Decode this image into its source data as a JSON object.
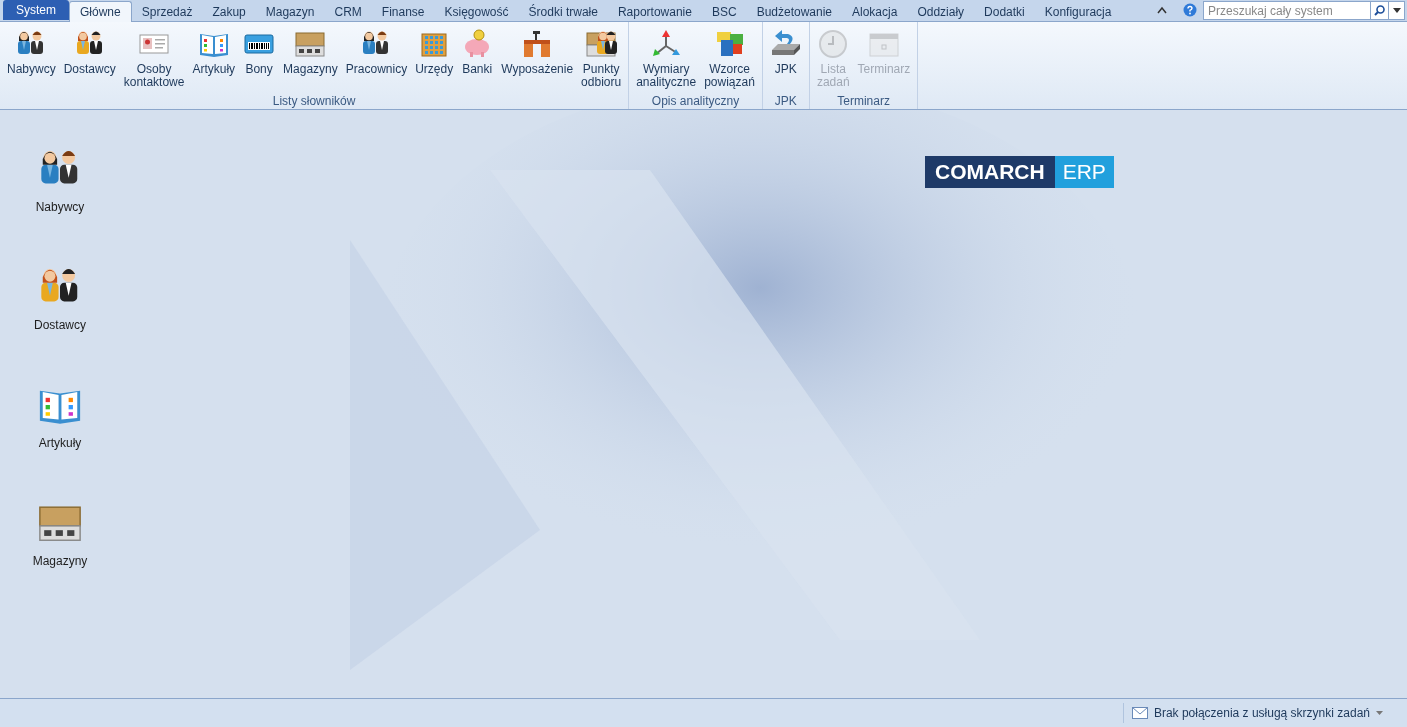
{
  "tabs": [
    {
      "label": "System",
      "kind": "system",
      "selected": false
    },
    {
      "label": "Główne",
      "kind": "tab",
      "selected": true
    },
    {
      "label": "Sprzedaż",
      "kind": "tab",
      "selected": false
    },
    {
      "label": "Zakup",
      "kind": "tab",
      "selected": false
    },
    {
      "label": "Magazyn",
      "kind": "tab",
      "selected": false
    },
    {
      "label": "CRM",
      "kind": "tab",
      "selected": false
    },
    {
      "label": "Finanse",
      "kind": "tab",
      "selected": false
    },
    {
      "label": "Księgowość",
      "kind": "tab",
      "selected": false
    },
    {
      "label": "Środki trwałe",
      "kind": "tab",
      "selected": false
    },
    {
      "label": "Raportowanie",
      "kind": "tab",
      "selected": false
    },
    {
      "label": "BSC",
      "kind": "tab",
      "selected": false
    },
    {
      "label": "Budżetowanie",
      "kind": "tab",
      "selected": false
    },
    {
      "label": "Alokacja",
      "kind": "tab",
      "selected": false
    },
    {
      "label": "Oddziały",
      "kind": "tab",
      "selected": false
    },
    {
      "label": "Dodatki",
      "kind": "tab",
      "selected": false
    },
    {
      "label": "Konfiguracja",
      "kind": "tab",
      "selected": false
    }
  ],
  "search": {
    "placeholder": "Przeszukaj cały system"
  },
  "ribbon_groups": [
    {
      "label": "Listy słowników",
      "items": [
        {
          "label": "Nabywcy",
          "kind": "buyers",
          "disabled": false
        },
        {
          "label": "Dostawcy",
          "kind": "suppliers",
          "disabled": false
        },
        {
          "label": "Osoby kontaktowe",
          "kind": "contact",
          "disabled": false
        },
        {
          "label": "Artykuły",
          "kind": "book",
          "disabled": false
        },
        {
          "label": "Bony",
          "kind": "voucher",
          "disabled": false
        },
        {
          "label": "Magazyny",
          "kind": "warehouse",
          "disabled": false
        },
        {
          "label": "Pracownicy",
          "kind": "buyers",
          "disabled": false
        },
        {
          "label": "Urzędy",
          "kind": "building",
          "disabled": false
        },
        {
          "label": "Banki",
          "kind": "piggy",
          "disabled": false
        },
        {
          "label": "Wyposażenie",
          "kind": "desk",
          "disabled": false
        },
        {
          "label": "Punkty odbioru",
          "kind": "pickup",
          "disabled": false
        }
      ]
    },
    {
      "label": "Opis analityczny",
      "items": [
        {
          "label": "Wymiary analityczne",
          "kind": "axes",
          "disabled": false
        },
        {
          "label": "Wzorce powiązań",
          "kind": "blocks",
          "disabled": false
        }
      ]
    },
    {
      "label": "JPK",
      "items": [
        {
          "label": "JPK",
          "kind": "jpk",
          "disabled": false
        }
      ]
    },
    {
      "label": "Terminarz",
      "items": [
        {
          "label": "Lista zadań",
          "kind": "clock",
          "disabled": true
        },
        {
          "label": "Terminarz",
          "kind": "calendar",
          "disabled": true
        }
      ]
    }
  ],
  "shortcuts": [
    {
      "label": "Nabywcy",
      "kind": "buyers"
    },
    {
      "label": "Dostawcy",
      "kind": "suppliers"
    },
    {
      "label": "Artykuły",
      "kind": "book"
    },
    {
      "label": "Magazyny",
      "kind": "warehouse"
    }
  ],
  "logo": {
    "brand": "COMARCH",
    "product": "ERP"
  },
  "status_bar": {
    "message": "Brak połączenia z usługą skrzynki zadań"
  }
}
